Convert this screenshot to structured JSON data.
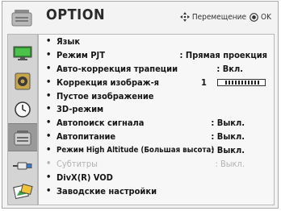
{
  "header": {
    "title": "OPTION",
    "move_hint": "Перемещение",
    "ok_hint": "OK"
  },
  "sidebar": {
    "items": [
      {
        "icon": "picture-icon"
      },
      {
        "icon": "speaker-icon"
      },
      {
        "icon": "clock-icon"
      },
      {
        "icon": "option-icon",
        "active": true
      },
      {
        "icon": "input-icon"
      },
      {
        "icon": "media-icon"
      }
    ]
  },
  "menu": {
    "items": [
      {
        "label": "Язык",
        "value": ""
      },
      {
        "label": "Режим PJT",
        "value": ": Прямая проекция"
      },
      {
        "label": "Авто-коррекция трапеции",
        "value": ": Вкл."
      },
      {
        "label": "Коррекция изображ-я",
        "value": "1",
        "gauge_level": 1.0
      },
      {
        "label": "Пустое изображение",
        "value": ""
      },
      {
        "label": "3D-режим",
        "value": ""
      },
      {
        "label": "Автопоиск сигнала",
        "value": ": Выкл."
      },
      {
        "label": "Автопитание",
        "value": ": Выкл."
      },
      {
        "label": "Режим High Altitude (Большая высота)",
        "value": ": Выкл."
      },
      {
        "label": "Субтитры",
        "value": ": Выкл.",
        "disabled": true
      },
      {
        "label": "DivX(R) VOD",
        "value": ""
      },
      {
        "label": "Заводские настройки",
        "value": ""
      }
    ],
    "bullet": "•"
  },
  "colors": {
    "background": "#f3f3f3",
    "active_tab": "#9a9a9a",
    "disabled_text": "#b3b3b3"
  }
}
